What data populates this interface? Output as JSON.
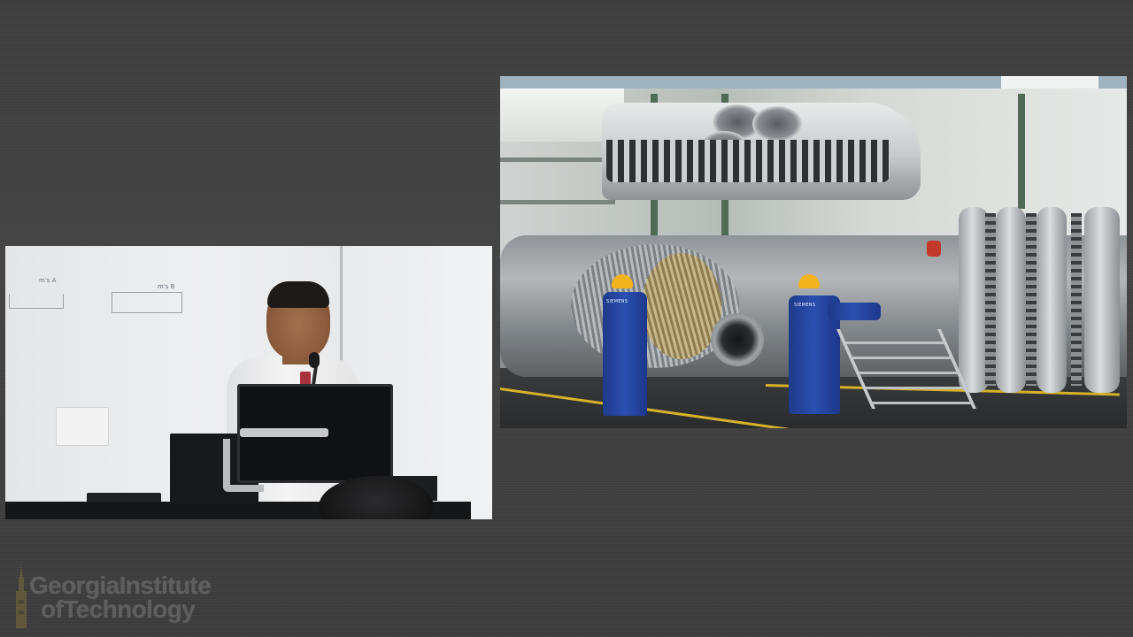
{
  "speaker_video": {
    "board_notes": [
      "m's A",
      "m's B"
    ]
  },
  "slide_image": {
    "worker_jacket_text": "SIEMENS"
  },
  "branding": {
    "logo_line1": "GeorgiaInstitute",
    "logo_line2": "ofTechnology",
    "logo_color": "#8c8c8c"
  },
  "colors": {
    "background": "#404040",
    "helmet": "#f2b21b",
    "coverall": "#2a4fb0"
  }
}
